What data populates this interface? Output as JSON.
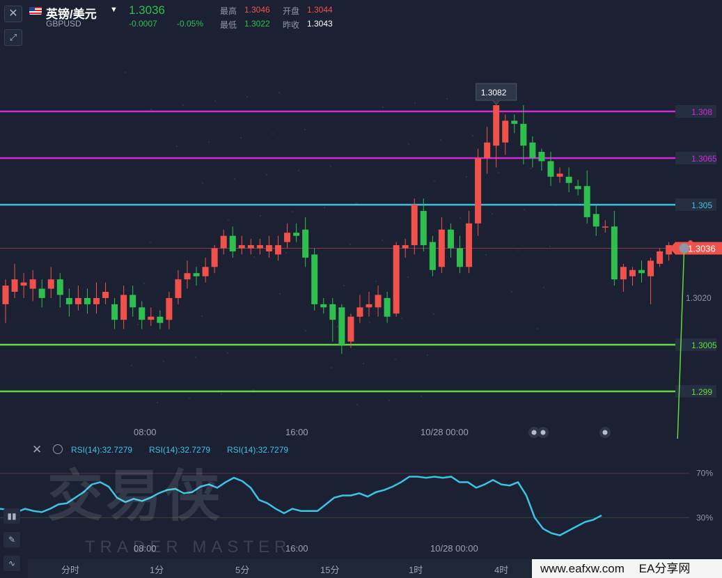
{
  "header": {
    "symbol_name": "英镑/美元",
    "symbol_code": "GBPUSD",
    "price": "1.3036",
    "change": "-0.0007",
    "change_pct": "-0.05%",
    "stats": [
      {
        "label": "最高",
        "value": "1.3046",
        "color": "#f0524b"
      },
      {
        "label": "开盘",
        "value": "1.3044",
        "color": "#f0524b"
      },
      {
        "label": "最低",
        "value": "1.3022",
        "color": "#2fbf4f"
      },
      {
        "label": "昨收",
        "value": "1.3043",
        "color": "#ffffff"
      }
    ]
  },
  "chart_data": {
    "type": "candlestick",
    "symbol": "GBPUSD",
    "ylim": [
      1.2977,
      1.3095
    ],
    "x_ticks": [
      "08:00",
      "16:00",
      "10/28 00:00"
    ],
    "price_labels": [
      "1.3020"
    ],
    "current_price": "1.3036",
    "peak_callout": "1.3082",
    "colors": {
      "up": "#f0524b",
      "down": "#2fbf4f"
    },
    "horizontal_lines": [
      {
        "label": "1.308",
        "value": 1.308,
        "color": "#d429d6"
      },
      {
        "label": "1.3065",
        "value": 1.3065,
        "color": "#d429d6"
      },
      {
        "label": "1.305",
        "value": 1.305,
        "color": "#3ec3de"
      },
      {
        "label": "1.3005",
        "value": 1.3005,
        "color": "#63dc3a"
      },
      {
        "label": "1.299",
        "value": 1.299,
        "color": "#63dc3a"
      }
    ],
    "candles": [
      [
        1.3018,
        1.3024,
        1.3012,
        1.3026
      ],
      [
        1.3022,
        1.3026,
        1.302,
        1.3031
      ],
      [
        1.3024,
        1.3025,
        1.302,
        1.3028
      ],
      [
        1.3023,
        1.3026,
        1.3019,
        1.3029
      ],
      [
        1.3023,
        1.302,
        1.3017,
        1.3026
      ],
      [
        1.3023,
        1.3026,
        1.302,
        1.303
      ],
      [
        1.3026,
        1.3021,
        1.3017,
        1.3028
      ],
      [
        1.302,
        1.3018,
        1.3014,
        1.3023
      ],
      [
        1.3018,
        1.302,
        1.3016,
        1.3024
      ],
      [
        1.302,
        1.3018,
        1.3015,
        1.3023
      ],
      [
        1.3018,
        1.302,
        1.3015,
        1.3025
      ],
      [
        1.302,
        1.3022,
        1.3018,
        1.3025
      ],
      [
        1.3018,
        1.3013,
        1.301,
        1.302
      ],
      [
        1.3013,
        1.3021,
        1.301,
        1.3024
      ],
      [
        1.3021,
        1.3017,
        1.3014,
        1.3024
      ],
      [
        1.3017,
        1.3013,
        1.301,
        1.3019
      ],
      [
        1.3013,
        1.3014,
        1.3011,
        1.3017
      ],
      [
        1.3014,
        1.3012,
        1.301,
        1.3016
      ],
      [
        1.3013,
        1.302,
        1.301,
        1.3022
      ],
      [
        1.302,
        1.3026,
        1.3018,
        1.3029
      ],
      [
        1.3026,
        1.3028,
        1.3023,
        1.3032
      ],
      [
        1.3028,
        1.3027,
        1.3024,
        1.303
      ],
      [
        1.3027,
        1.303,
        1.3025,
        1.3033
      ],
      [
        1.303,
        1.3036,
        1.3028,
        1.3037
      ],
      [
        1.3036,
        1.304,
        1.3034,
        1.3042
      ],
      [
        1.304,
        1.3035,
        1.3033,
        1.3043
      ],
      [
        1.3036,
        1.3037,
        1.3034,
        1.304
      ],
      [
        1.3036,
        1.3037,
        1.3034,
        1.3039
      ],
      [
        1.3036,
        1.3037,
        1.3034,
        1.3039
      ],
      [
        1.3035,
        1.3037,
        1.3033,
        1.304
      ],
      [
        1.3034,
        1.3037,
        1.3032,
        1.304
      ],
      [
        1.3038,
        1.3041,
        1.3036,
        1.3044
      ],
      [
        1.3041,
        1.304,
        1.3038,
        1.3044
      ],
      [
        1.3042,
        1.3033,
        1.303,
        1.3046
      ],
      [
        1.3034,
        1.3018,
        1.3016,
        1.3036
      ],
      [
        1.3018,
        1.3017,
        1.3015,
        1.302
      ],
      [
        1.3018,
        1.3013,
        1.3006,
        1.302
      ],
      [
        1.3017,
        1.3005,
        1.3002,
        1.3018
      ],
      [
        1.3006,
        1.3014,
        1.3004,
        1.3015
      ],
      [
        1.3014,
        1.3017,
        1.3012,
        1.3021
      ],
      [
        1.3017,
        1.3018,
        1.3014,
        1.3022
      ],
      [
        1.3017,
        1.3021,
        1.3014,
        1.3024
      ],
      [
        1.302,
        1.3014,
        1.3012,
        1.3022
      ],
      [
        1.3015,
        1.3037,
        1.3014,
        1.3038
      ],
      [
        1.3036,
        1.3037,
        1.3033,
        1.3039
      ],
      [
        1.3037,
        1.305,
        1.3034,
        1.3052
      ],
      [
        1.3048,
        1.3037,
        1.3035,
        1.3052
      ],
      [
        1.3038,
        1.3029,
        1.3027,
        1.304
      ],
      [
        1.303,
        1.3042,
        1.3028,
        1.3046
      ],
      [
        1.3042,
        1.3036,
        1.3033,
        1.3044
      ],
      [
        1.3036,
        1.303,
        1.3028,
        1.304
      ],
      [
        1.303,
        1.3044,
        1.3028,
        1.3048
      ],
      [
        1.3044,
        1.3065,
        1.304,
        1.3068
      ],
      [
        1.3065,
        1.307,
        1.306,
        1.3075
      ],
      [
        1.3069,
        1.3082,
        1.3062,
        1.3084
      ],
      [
        1.307,
        1.3077,
        1.3066,
        1.3079
      ],
      [
        1.3077,
        1.3076,
        1.3073,
        1.3079
      ],
      [
        1.3076,
        1.3069,
        1.3063,
        1.3082
      ],
      [
        1.307,
        1.3065,
        1.3062,
        1.3072
      ],
      [
        1.3067,
        1.3064,
        1.3061,
        1.3068
      ],
      [
        1.3064,
        1.3059,
        1.3056,
        1.3067
      ],
      [
        1.3059,
        1.306,
        1.3057,
        1.3062
      ],
      [
        1.3059,
        1.3057,
        1.3054,
        1.3062
      ],
      [
        1.3056,
        1.3055,
        1.3053,
        1.3058
      ],
      [
        1.3056,
        1.3046,
        1.3044,
        1.3061
      ],
      [
        1.3047,
        1.3043,
        1.304,
        1.305
      ],
      [
        1.3043,
        1.3043,
        1.3041,
        1.3045
      ],
      [
        1.3043,
        1.3026,
        1.3024,
        1.3048
      ],
      [
        1.3026,
        1.303,
        1.3022,
        1.3031
      ],
      [
        1.3027,
        1.3029,
        1.3024,
        1.303
      ],
      [
        1.3029,
        1.3028,
        1.3025,
        1.3032
      ],
      [
        1.3027,
        1.3032,
        1.3018,
        1.3033
      ],
      [
        1.3031,
        1.3035,
        1.303,
        1.3036
      ],
      [
        1.3034,
        1.3037,
        1.3032,
        1.3038
      ]
    ],
    "projection": {
      "from": [
        1.3036
      ],
      "to": [
        1.2967
      ]
    }
  },
  "rsi": {
    "labels": [
      "RSI(14):32.7279",
      "RSI(14):32.7279",
      "RSI(14):32.7279"
    ],
    "level_labels": [
      "70%",
      "30%"
    ],
    "x_ticks": [
      "08:00",
      "16:00",
      "10/28 00:00"
    ],
    "line_color": "#3cc4e3",
    "values": [
      38,
      37,
      35,
      38,
      36,
      35,
      38,
      42,
      43,
      48,
      53,
      60,
      62,
      58,
      48,
      44,
      47,
      45,
      48,
      52,
      55,
      56,
      52,
      53,
      58,
      60,
      57,
      62,
      66,
      63,
      57,
      46,
      43,
      38,
      34,
      38,
      36,
      36,
      36,
      42,
      48,
      50,
      50,
      52,
      49,
      53,
      55,
      58,
      62,
      67,
      67,
      66,
      67,
      66,
      67,
      62,
      62,
      57,
      60,
      64,
      60,
      59,
      62,
      50,
      30,
      20,
      16,
      14,
      18,
      22,
      26,
      28,
      32
    ]
  },
  "watermark": {
    "cn": "交易侠",
    "en": "TRADER MASTER"
  },
  "timeframes": [
    "分时",
    "1分",
    "5分",
    "15分",
    "1时",
    "4时"
  ],
  "site_label": "www.eafxw.com",
  "site_label2": "EA分享网",
  "icons": {
    "close": "close-icon",
    "expand": "expand-icon",
    "eye": "eye-icon",
    "indicator": "candles-icon",
    "pen": "pen-icon",
    "line": "line-tool-icon"
  }
}
